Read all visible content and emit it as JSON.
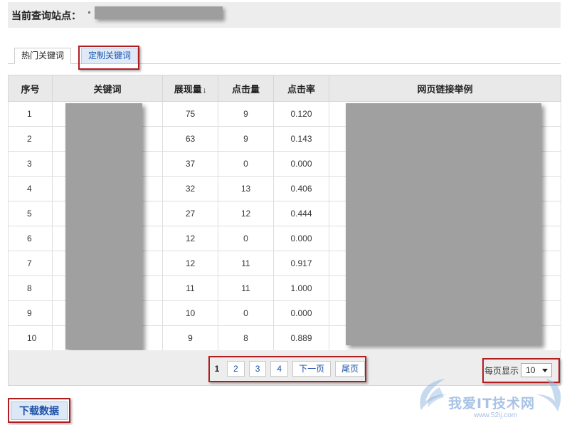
{
  "header": {
    "site_label": "当前查询站点："
  },
  "tabs": [
    {
      "label": "热门关键词",
      "active": true
    },
    {
      "label": "定制关键词",
      "active": false
    }
  ],
  "table": {
    "columns": [
      "序号",
      "关键词",
      "展现量",
      "点击量",
      "点击率",
      "网页链接举例"
    ],
    "sort_indicator": "↓",
    "rows": [
      {
        "idx": "1",
        "impressions": "75",
        "clicks": "9",
        "ctr": "0.120"
      },
      {
        "idx": "2",
        "impressions": "63",
        "clicks": "9",
        "ctr": "0.143"
      },
      {
        "idx": "3",
        "impressions": "37",
        "clicks": "0",
        "ctr": "0.000"
      },
      {
        "idx": "4",
        "impressions": "32",
        "clicks": "13",
        "ctr": "0.406"
      },
      {
        "idx": "5",
        "impressions": "27",
        "clicks": "12",
        "ctr": "0.444"
      },
      {
        "idx": "6",
        "impressions": "12",
        "clicks": "0",
        "ctr": "0.000"
      },
      {
        "idx": "7",
        "impressions": "12",
        "clicks": "11",
        "ctr": "0.917"
      },
      {
        "idx": "8",
        "impressions": "11",
        "clicks": "11",
        "ctr": "1.000"
      },
      {
        "idx": "9",
        "impressions": "10",
        "clicks": "0",
        "ctr": "0.000"
      },
      {
        "idx": "10",
        "impressions": "9",
        "clicks": "8",
        "ctr": "0.889"
      }
    ]
  },
  "pager": {
    "current": "1",
    "pages": [
      "2",
      "3",
      "4"
    ],
    "next_label": "下一页",
    "last_label": "尾页"
  },
  "per_page": {
    "label": "每页显示",
    "value": "10"
  },
  "download_label": "下载数据",
  "watermark": {
    "text": "我爱IT技术网",
    "url": "www.52ij.com"
  },
  "colors": {
    "highlight_border": "#b01e22",
    "link": "#1a4fa8",
    "header_bg": "#e9e9e9",
    "mask": "#a0a0a0"
  }
}
